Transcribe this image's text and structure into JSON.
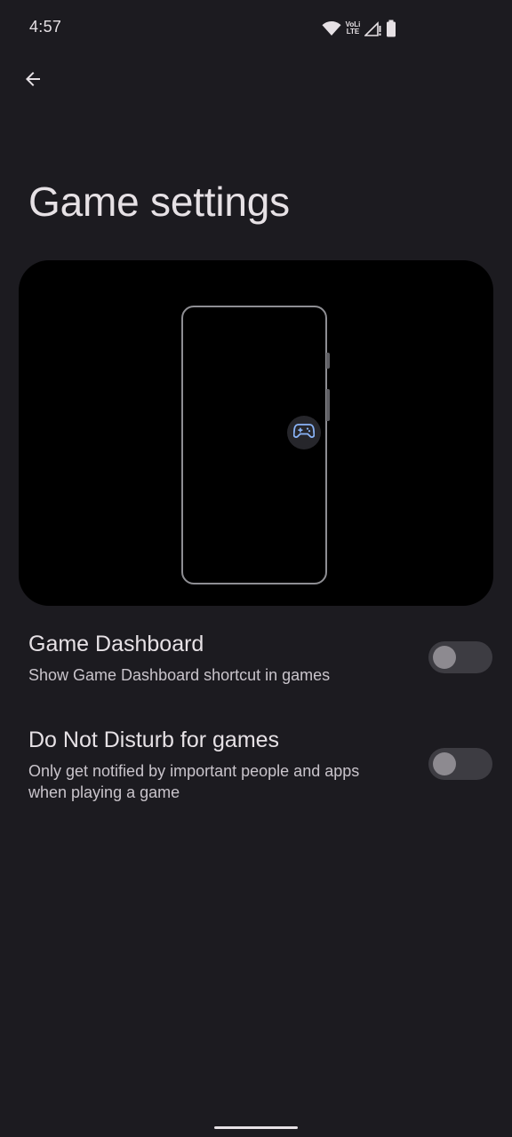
{
  "status_bar": {
    "time": "4:57",
    "icons": [
      "wifi-icon",
      "volte-icon",
      "signal-icon",
      "battery-icon"
    ],
    "volte_line1": "VoLi",
    "volte_line2": "LTE"
  },
  "header": {
    "back_icon": "arrow-back-icon",
    "title": "Game settings"
  },
  "illustration": {
    "shortcut_icon": "gamepad-icon",
    "accent_color": "#8ab4f8"
  },
  "settings": [
    {
      "title": "Game Dashboard",
      "summary": "Show Game Dashboard shortcut in games",
      "enabled": false
    },
    {
      "title": "Do Not Disturb for games",
      "summary": "Only get notified by important people and apps when playing a game",
      "enabled": false
    }
  ],
  "colors": {
    "background": "#1c1b20",
    "text_primary": "#e6e1e5",
    "text_secondary": "#c9c4cb",
    "toggle_track_off": "#3d3c42",
    "toggle_thumb_off": "#8d8a90"
  }
}
